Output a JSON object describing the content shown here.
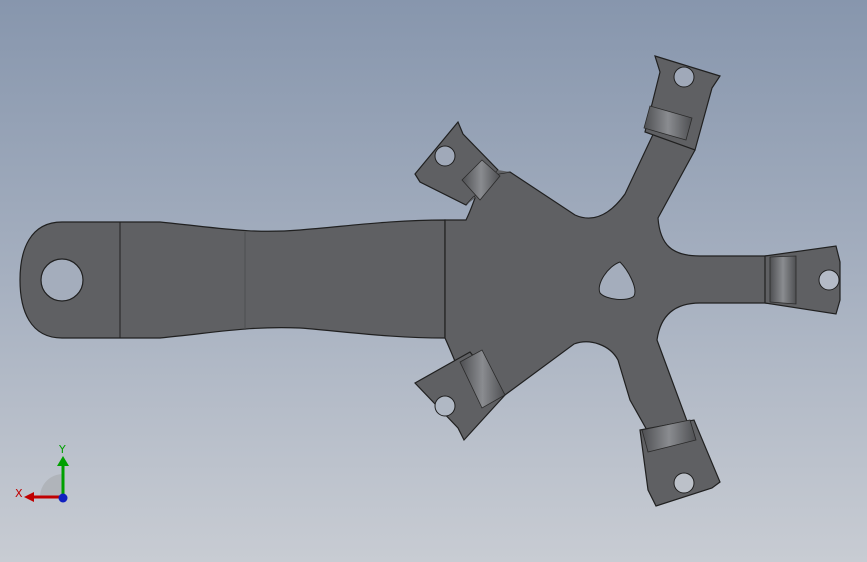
{
  "viewport": {
    "colors": {
      "background_top": "#8796ad",
      "background_bottom": "#c8ccd3",
      "part_fill": "#5f6063",
      "edge": "#202020",
      "x_axis": "#c00000",
      "y_axis": "#00a000",
      "z_axis": "#1020c0"
    }
  },
  "triad": {
    "x_label": "X",
    "y_label": "Y"
  }
}
